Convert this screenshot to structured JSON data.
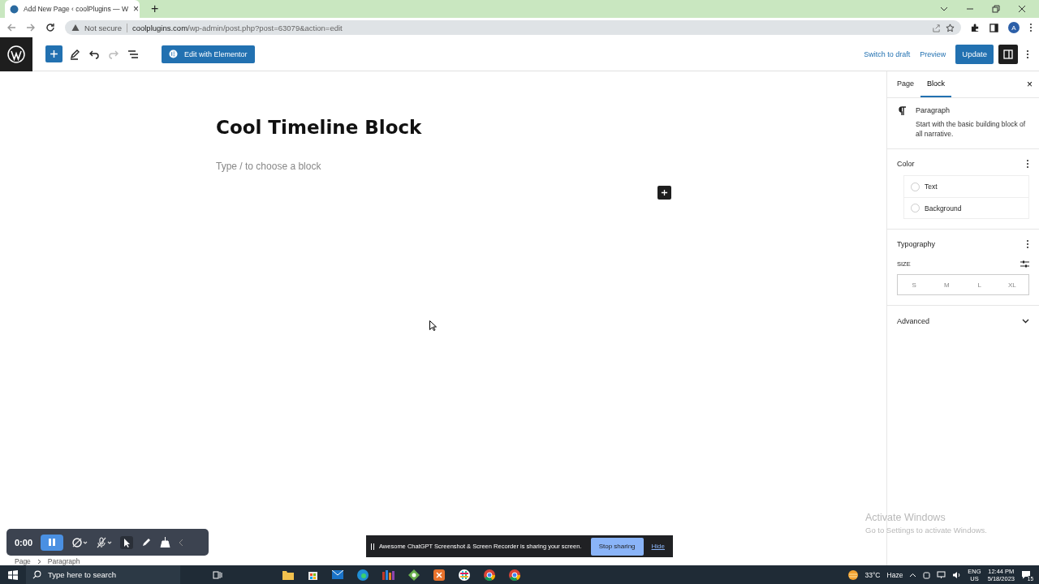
{
  "browser": {
    "tab": {
      "title": "Add New Page ‹ coolPlugins — W",
      "close": "×"
    },
    "new_tab": "+",
    "address": {
      "security": "Not secure",
      "url_host": "coolplugins.com",
      "url_path": "/wp-admin/post.php?post=63079&action=edit"
    },
    "avatar": "A"
  },
  "toolbar": {
    "edit_button": "Edit with Elementor",
    "switch_to_draft": "Switch to draft",
    "preview": "Preview",
    "update": "Update"
  },
  "editor": {
    "title": "Cool Timeline Block",
    "placeholder": "Type / to choose a block"
  },
  "breadcrumb": [
    "Page",
    "Paragraph"
  ],
  "sidebar": {
    "tabs": [
      {
        "label": "Page",
        "selected": false
      },
      {
        "label": "Block",
        "selected": true
      }
    ],
    "block": {
      "name": "Paragraph",
      "description": "Start with the basic building block of all narrative."
    },
    "color": {
      "title": "Color",
      "items": [
        "Text",
        "Background"
      ]
    },
    "typography": {
      "title": "Typography",
      "size_label": "SIZE",
      "sizes": [
        "S",
        "M",
        "L",
        "XL"
      ]
    },
    "advanced": {
      "title": "Advanced",
      "expanded": false
    }
  },
  "recorder": {
    "time": "0:00"
  },
  "share_notice": {
    "message": "Awesome ChatGPT Screenshot & Screen Recorder is sharing your screen.",
    "stop": "Stop sharing",
    "hide": "Hide"
  },
  "os_notice": {
    "title": "Activate Windows",
    "subtitle": "Go to Settings to activate Windows."
  },
  "taskbar": {
    "search_placeholder": "Type here to search",
    "weather": {
      "temp": "33°C",
      "condition": "Haze"
    },
    "language": [
      "ENG",
      "US"
    ],
    "time": "12:44 PM",
    "date": "5/18/2023",
    "notifications": "15"
  }
}
